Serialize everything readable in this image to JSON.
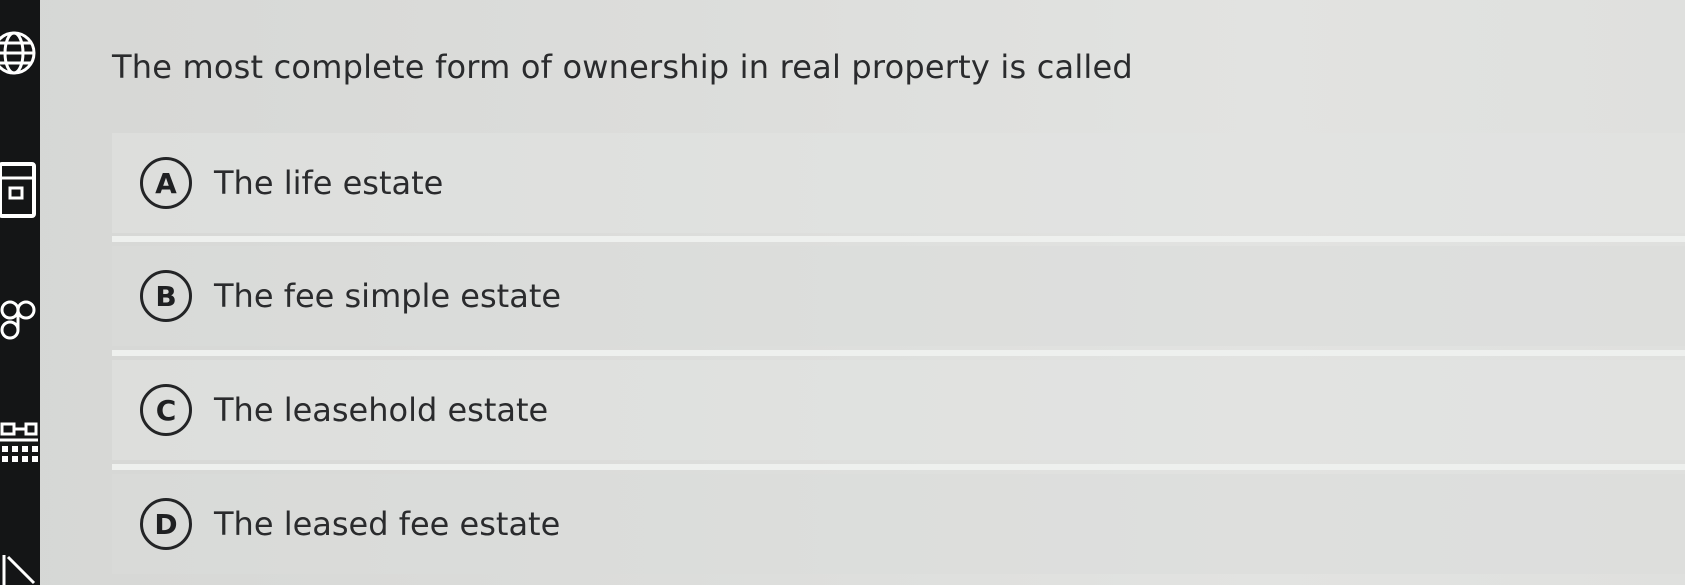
{
  "sidebar": {
    "icons": [
      "globe-icon",
      "calculator-icon",
      "glasses-icon",
      "grid-icon",
      "collapse-icon"
    ]
  },
  "question": {
    "text": "The most complete form of ownership in real property is called"
  },
  "options": [
    {
      "letter": "A",
      "text": "The life estate"
    },
    {
      "letter": "B",
      "text": "The fee simple estate"
    },
    {
      "letter": "C",
      "text": "The leasehold estate"
    },
    {
      "letter": "D",
      "text": "The leased fee estate"
    }
  ]
}
